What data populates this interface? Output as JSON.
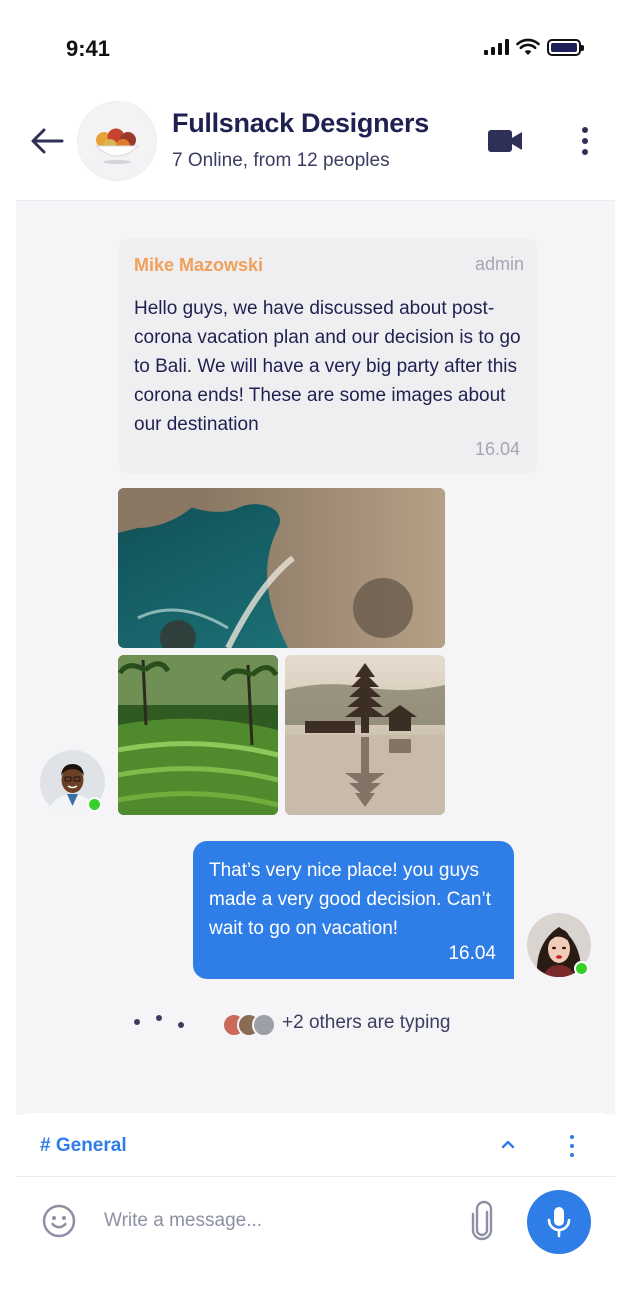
{
  "status_bar": {
    "time": "9:41"
  },
  "header": {
    "title": "Fullsnack Designers",
    "subtitle": "7 Online, from 12 peoples",
    "icons": {
      "back": "arrow-left-icon",
      "video": "video-camera-icon",
      "more": "more-vertical-icon"
    }
  },
  "messages": [
    {
      "sender": "Mike Mazowski",
      "role": "admin",
      "text": "Hello guys, we have discussed about post-corona vacation plan and our decision is to go to Bali. We will have a very big party after this corona ends! These are some images about our destination",
      "time": "16.04",
      "images": [
        "Bali coastline cliffs",
        "Rice terraces",
        "Water temple"
      ]
    },
    {
      "sender": "me",
      "text": "That’s very nice place! you guys made a very good decision. Can’t wait to go on vacation!",
      "time": "16.04"
    }
  ],
  "typing": {
    "text": "+2 others are typing"
  },
  "channel": {
    "name": "# General"
  },
  "composer": {
    "placeholder": "Write a message..."
  },
  "colors": {
    "accent": "#2f7de6",
    "sender_name": "#f0a05a",
    "online": "#36d02b",
    "title": "#1f2150",
    "chat_bg": "#f5f5f7"
  }
}
